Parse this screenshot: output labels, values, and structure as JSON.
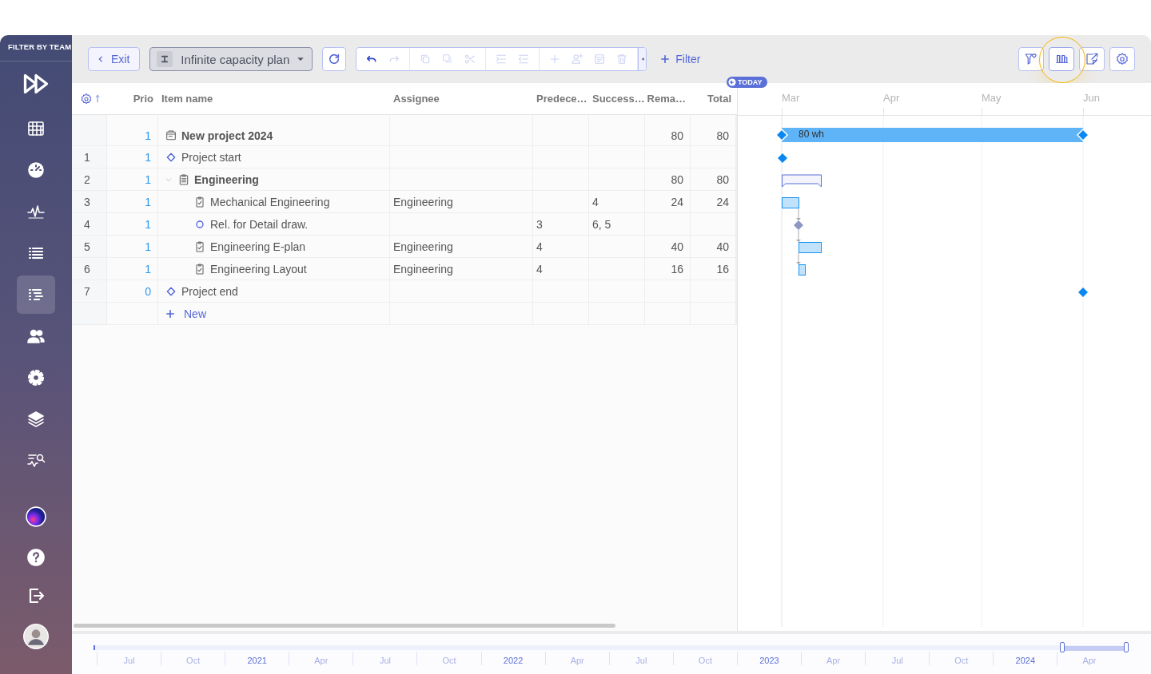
{
  "sidebar": {
    "title": "FILTER BY TEAM",
    "items": [
      {
        "kind": "grid",
        "selected": false
      },
      {
        "kind": "gauge",
        "selected": false
      },
      {
        "kind": "pulse",
        "selected": false
      },
      {
        "kind": "list",
        "selected": false
      },
      {
        "kind": "gantt",
        "selected": true
      },
      {
        "kind": "people",
        "selected": false
      },
      {
        "kind": "gear",
        "selected": false
      },
      {
        "kind": "layers",
        "selected": false
      },
      {
        "kind": "search-list",
        "selected": false
      }
    ],
    "footer": [
      {
        "kind": "orb"
      },
      {
        "kind": "help"
      },
      {
        "kind": "logout"
      },
      {
        "kind": "avatar"
      }
    ]
  },
  "toolbar": {
    "exit": "Exit",
    "plan": "Infinite capacity plan",
    "tools": [
      {
        "kind": "undo",
        "disabled": false
      },
      {
        "kind": "redo",
        "disabled": true
      },
      {
        "kind": "copy",
        "disabled": true
      },
      {
        "kind": "duplicate",
        "disabled": true
      },
      {
        "kind": "cut",
        "disabled": true
      },
      {
        "kind": "indent",
        "disabled": true
      },
      {
        "kind": "outdent",
        "disabled": true
      },
      {
        "kind": "add",
        "disabled": true
      },
      {
        "kind": "add-person",
        "disabled": true
      },
      {
        "kind": "details",
        "disabled": true
      },
      {
        "kind": "delete",
        "disabled": true
      }
    ],
    "filter": "Filter",
    "views": [
      {
        "kind": "favorite-filter",
        "highlighted": false
      },
      {
        "kind": "columns",
        "highlighted": true
      },
      {
        "kind": "export",
        "highlighted": false
      },
      {
        "kind": "settings",
        "highlighted": false
      }
    ]
  },
  "table": {
    "columns": [
      "Prio",
      "Item name",
      "Assignee",
      "Predece…",
      "Success…",
      "Rema…",
      "Total"
    ],
    "rows": [
      {
        "prio": "1",
        "name": "New project 2024",
        "kind": "project",
        "remaining": "80",
        "total": "80",
        "bar_label": "80 wh"
      },
      {
        "number": "1",
        "prio": "1",
        "name": "Project start",
        "kind": "milestone"
      },
      {
        "number": "2",
        "prio": "1",
        "name": "Engineering",
        "kind": "summary",
        "expanded": true,
        "remaining": "80",
        "total": "80",
        "children": [
          {
            "number": "3",
            "prio": "1",
            "name": "Mechanical Engineering",
            "kind": "task",
            "assignee": "Engineering",
            "successors": "4",
            "remaining": "24",
            "total": "24"
          },
          {
            "number": "4",
            "prio": "1",
            "name": "Rel. for Detail draw.",
            "kind": "event",
            "predecessors": "3",
            "successors": "6, 5"
          },
          {
            "number": "5",
            "prio": "1",
            "name": "Engineering E-plan",
            "kind": "task",
            "assignee": "Engineering",
            "predecessors": "4",
            "remaining": "40",
            "total": "40"
          },
          {
            "number": "6",
            "prio": "1",
            "name": "Engineering Layout",
            "kind": "task",
            "assignee": "Engineering",
            "predecessors": "4",
            "remaining": "16",
            "total": "16"
          }
        ]
      },
      {
        "number": "7",
        "prio": "0",
        "name": "Project end",
        "kind": "milestone"
      }
    ],
    "new_row": "New"
  },
  "gantt": {
    "today": "TODAY",
    "months": [
      "Mar",
      "Apr",
      "May",
      "Jun"
    ]
  },
  "navigator": {
    "labels": [
      {
        "text": "Jul",
        "kind": "month"
      },
      {
        "text": "Oct",
        "kind": "month"
      },
      {
        "text": "2021",
        "kind": "year"
      },
      {
        "text": "Apr",
        "kind": "month"
      },
      {
        "text": "Jul",
        "kind": "month"
      },
      {
        "text": "Oct",
        "kind": "month"
      },
      {
        "text": "2022",
        "kind": "year"
      },
      {
        "text": "Apr",
        "kind": "month"
      },
      {
        "text": "Jul",
        "kind": "month"
      },
      {
        "text": "Oct",
        "kind": "month"
      },
      {
        "text": "2023",
        "kind": "year"
      },
      {
        "text": "Apr",
        "kind": "month"
      },
      {
        "text": "Jul",
        "kind": "month"
      },
      {
        "text": "Oct",
        "kind": "month"
      },
      {
        "text": "2024",
        "kind": "year"
      },
      {
        "text": "Apr",
        "kind": "month"
      }
    ]
  }
}
